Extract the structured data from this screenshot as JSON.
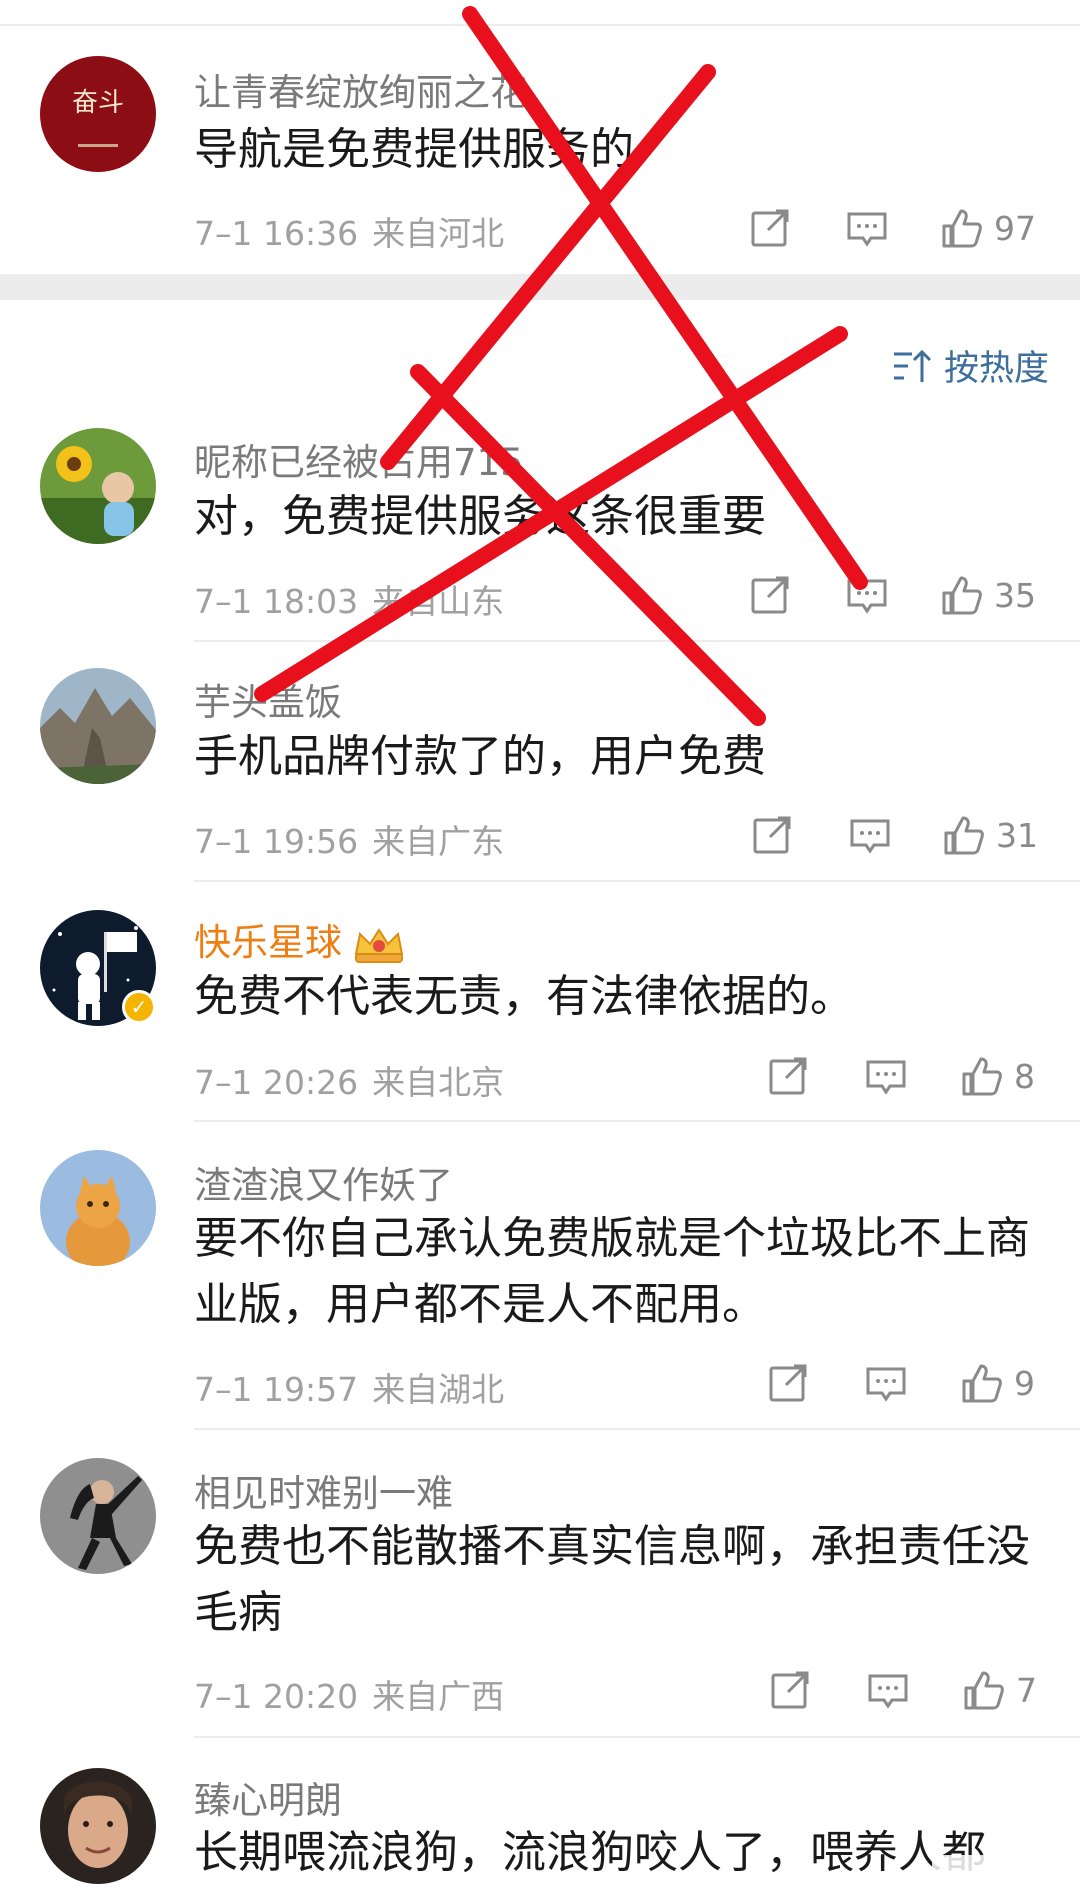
{
  "sort": {
    "label": "按热度"
  },
  "comments": [
    {
      "username": "让青春绽放绚丽之花",
      "content": "导航是免费提供服务的",
      "time": "7–1 16:36",
      "location": "来自河北",
      "likes": "97",
      "avatar_text": "奋斗"
    },
    {
      "username": "昵称已经被占用715",
      "content": "对，免费提供服务这条很重要",
      "time": "7–1 18:03",
      "location": "来自山东",
      "likes": "35"
    },
    {
      "username": "芋头盖饭",
      "content": "手机品牌付款了的，用户免费",
      "time": "7–1 19:56",
      "location": "来自广东",
      "likes": "31"
    },
    {
      "username": "快乐星球",
      "content": "免费不代表无责，有法律依据的。",
      "time": "7–1 20:26",
      "location": "来自北京",
      "likes": "8",
      "vip": true
    },
    {
      "username": "渣渣浪又作妖了",
      "content": "要不你自己承认免费版就是个垃圾比不上商业版，用户都不是人不配用。",
      "time": "7–1 19:57",
      "location": "来自湖北",
      "likes": "9"
    },
    {
      "username": "相见时难别一难",
      "content": "免费也不能散播不真实信息啊，承担责任没毛病",
      "time": "7–1 20:20",
      "location": "来自广西",
      "likes": "7"
    },
    {
      "username": "臻心明朗",
      "content": "长期喂流浪狗，流浪狗咬人了，喂养人都",
      "time": "",
      "location": "",
      "likes": ""
    }
  ],
  "colors": {
    "accent_link": "#3e6f9c",
    "vip_name": "#ee7d12",
    "red_mark": "#e8101c"
  }
}
